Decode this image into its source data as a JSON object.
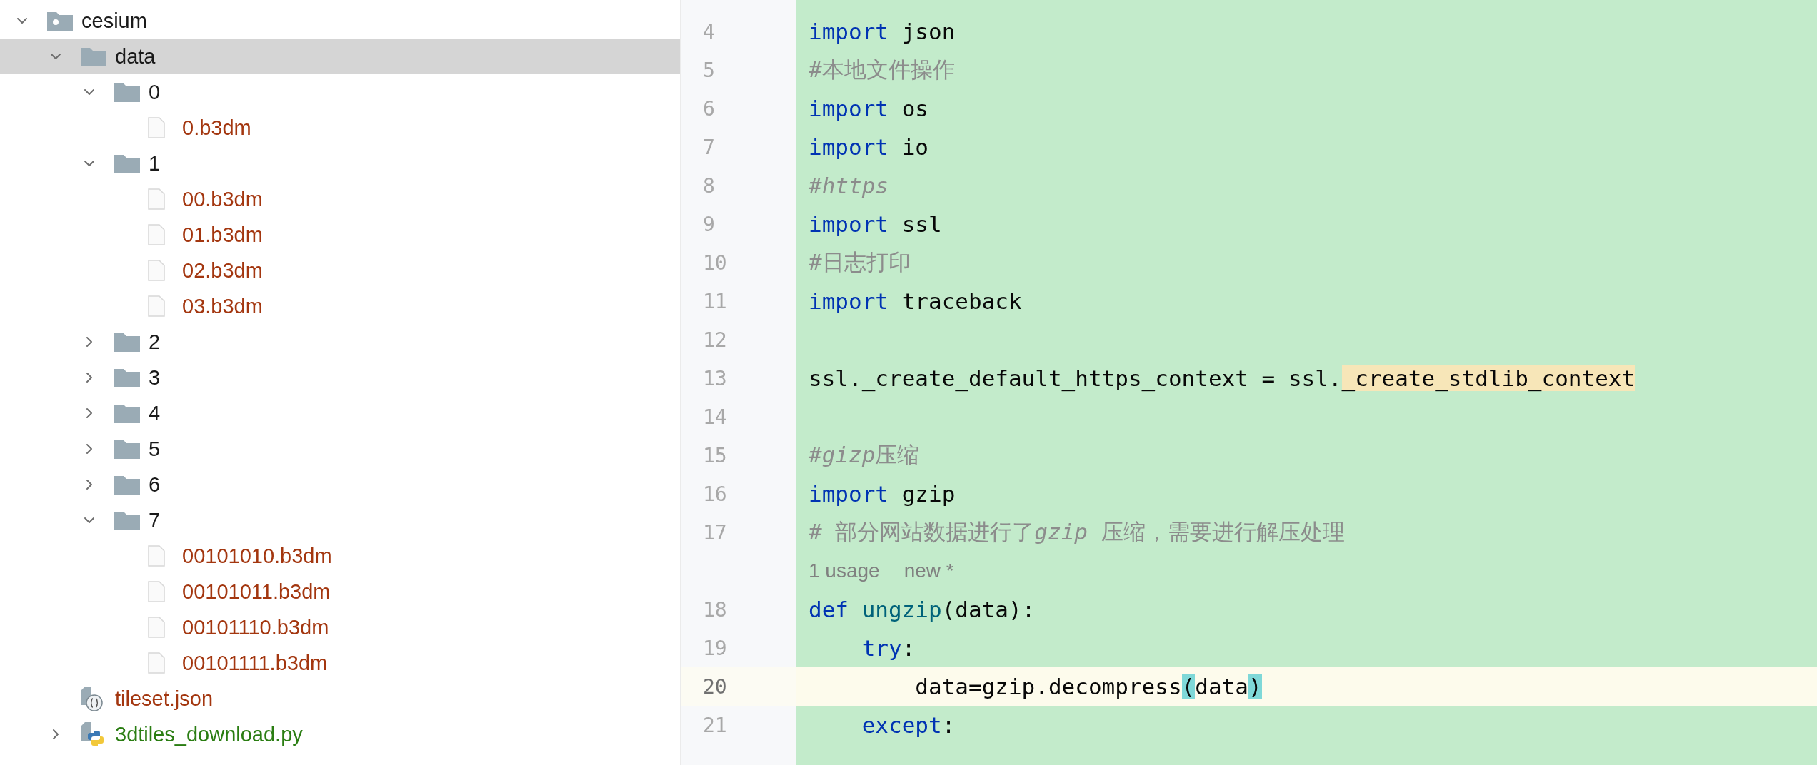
{
  "project_tree": {
    "items": [
      {
        "name": "cesium",
        "kind": "module",
        "color": "#1a1a1a",
        "expanded": true,
        "selected": false,
        "children": [
          {
            "name": "data",
            "kind": "folder",
            "color": "#1a1a1a",
            "expanded": true,
            "selected": true,
            "children": [
              {
                "name": "0",
                "kind": "folder",
                "color": "#1a1a1a",
                "expanded": true,
                "selected": false,
                "children": [
                  {
                    "name": "0.b3dm",
                    "kind": "file",
                    "color": "#a3360f",
                    "selected": false
                  }
                ]
              },
              {
                "name": "1",
                "kind": "folder",
                "color": "#1a1a1a",
                "expanded": true,
                "selected": false,
                "children": [
                  {
                    "name": "00.b3dm",
                    "kind": "file",
                    "color": "#a3360f",
                    "selected": false
                  },
                  {
                    "name": "01.b3dm",
                    "kind": "file",
                    "color": "#a3360f",
                    "selected": false
                  },
                  {
                    "name": "02.b3dm",
                    "kind": "file",
                    "color": "#a3360f",
                    "selected": false
                  },
                  {
                    "name": "03.b3dm",
                    "kind": "file",
                    "color": "#a3360f",
                    "selected": false
                  }
                ]
              },
              {
                "name": "2",
                "kind": "folder",
                "color": "#1a1a1a",
                "expanded": false,
                "selected": false
              },
              {
                "name": "3",
                "kind": "folder",
                "color": "#1a1a1a",
                "expanded": false,
                "selected": false
              },
              {
                "name": "4",
                "kind": "folder",
                "color": "#1a1a1a",
                "expanded": false,
                "selected": false
              },
              {
                "name": "5",
                "kind": "folder",
                "color": "#1a1a1a",
                "expanded": false,
                "selected": false
              },
              {
                "name": "6",
                "kind": "folder",
                "color": "#1a1a1a",
                "expanded": false,
                "selected": false
              },
              {
                "name": "7",
                "kind": "folder",
                "color": "#1a1a1a",
                "expanded": true,
                "selected": false,
                "children": [
                  {
                    "name": "00101010.b3dm",
                    "kind": "file",
                    "color": "#a3360f",
                    "selected": false
                  },
                  {
                    "name": "00101011.b3dm",
                    "kind": "file",
                    "color": "#a3360f",
                    "selected": false
                  },
                  {
                    "name": "00101110.b3dm",
                    "kind": "file",
                    "color": "#a3360f",
                    "selected": false
                  },
                  {
                    "name": "00101111.b3dm",
                    "kind": "file",
                    "color": "#a3360f",
                    "selected": false
                  }
                ]
              }
            ]
          },
          {
            "name": "tileset.json",
            "kind": "json",
            "color": "#a3360f",
            "selected": false
          },
          {
            "name": "3dtiles_download.py",
            "kind": "python",
            "color": "#2a7d12",
            "expanded": false,
            "selected": false
          }
        ]
      }
    ]
  },
  "editor": {
    "lines": [
      {
        "kind": "code",
        "number": "4",
        "current": false,
        "tokens": [
          {
            "kind": "keyword",
            "text": "import"
          },
          {
            "kind": "plain",
            "text": " json"
          }
        ]
      },
      {
        "kind": "code",
        "number": "5",
        "current": false,
        "tokens": [
          {
            "kind": "comment",
            "text": "#本地文件操作"
          }
        ]
      },
      {
        "kind": "code",
        "number": "6",
        "current": false,
        "tokens": [
          {
            "kind": "keyword",
            "text": "import"
          },
          {
            "kind": "plain",
            "text": " os"
          }
        ]
      },
      {
        "kind": "code",
        "number": "7",
        "current": false,
        "tokens": [
          {
            "kind": "keyword",
            "text": "import"
          },
          {
            "kind": "plain",
            "text": " io"
          }
        ]
      },
      {
        "kind": "code",
        "number": "8",
        "current": false,
        "tokens": [
          {
            "kind": "comment-italic",
            "text": "#https"
          }
        ]
      },
      {
        "kind": "code",
        "number": "9",
        "current": false,
        "tokens": [
          {
            "kind": "keyword",
            "text": "import"
          },
          {
            "kind": "plain",
            "text": " ssl"
          }
        ]
      },
      {
        "kind": "code",
        "number": "10",
        "current": false,
        "tokens": [
          {
            "kind": "comment",
            "text": "#日志打印"
          }
        ]
      },
      {
        "kind": "code",
        "number": "11",
        "current": false,
        "tokens": [
          {
            "kind": "keyword",
            "text": "import"
          },
          {
            "kind": "plain",
            "text": " traceback"
          }
        ]
      },
      {
        "kind": "blank",
        "number": "12",
        "current": false
      },
      {
        "kind": "code",
        "number": "13",
        "current": false,
        "tokens": [
          {
            "kind": "plain",
            "text": "ssl._create_default_https_context = ssl."
          },
          {
            "kind": "warning",
            "text": "_create_stdlib_context"
          }
        ]
      },
      {
        "kind": "blank",
        "number": "14",
        "current": false
      },
      {
        "kind": "code",
        "number": "15",
        "current": false,
        "tokens": [
          {
            "kind": "comment-italic",
            "text": "#gizp"
          },
          {
            "kind": "comment",
            "text": "压缩"
          }
        ]
      },
      {
        "kind": "code",
        "number": "16",
        "current": false,
        "tokens": [
          {
            "kind": "keyword",
            "text": "import"
          },
          {
            "kind": "plain",
            "text": " gzip"
          }
        ]
      },
      {
        "kind": "code",
        "number": "17",
        "current": false,
        "tokens": [
          {
            "kind": "comment",
            "text": "# 部分网站数据进行了"
          },
          {
            "kind": "comment-italic",
            "text": "gzip"
          },
          {
            "kind": "comment",
            "text": " 压缩，需要进行解压处理"
          }
        ]
      },
      {
        "kind": "inlay",
        "hints": [
          "1 usage",
          "new *"
        ]
      },
      {
        "kind": "code",
        "number": "18",
        "current": false,
        "tokens": [
          {
            "kind": "keyword",
            "text": "def"
          },
          {
            "kind": "function",
            "text": " ungzip"
          },
          {
            "kind": "plain",
            "text": "(data):"
          }
        ]
      },
      {
        "kind": "code",
        "number": "19",
        "current": false,
        "tokens": [
          {
            "kind": "keyword",
            "text": "    try"
          },
          {
            "kind": "plain",
            "text": ":"
          }
        ]
      },
      {
        "kind": "code",
        "number": "20",
        "current": true,
        "tokens": [
          {
            "kind": "plain",
            "text": "        data=gzip.decompress"
          },
          {
            "kind": "bracket",
            "text": "("
          },
          {
            "kind": "plain",
            "text": "data"
          },
          {
            "kind": "bracket",
            "text": ")"
          }
        ]
      },
      {
        "kind": "code",
        "number": "21",
        "current": false,
        "tokens": [
          {
            "kind": "keyword",
            "text": "    except"
          },
          {
            "kind": "plain",
            "text": ":"
          }
        ]
      }
    ]
  }
}
